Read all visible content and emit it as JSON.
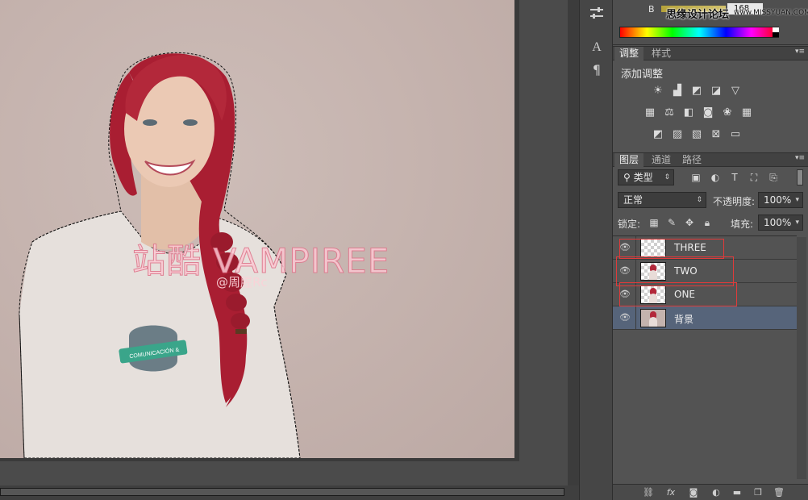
{
  "canvas": {
    "watermark_title": "站酷 VAMPIREE",
    "watermark_handle": "@周腥Rc"
  },
  "color_panel": {
    "channel_label": "B",
    "channel_value": "168",
    "overlay_site_cn": "思缘设计论坛",
    "overlay_site_url": "www.MISSYUAN.COM"
  },
  "adjustments": {
    "tabs": [
      "调整",
      "样式"
    ],
    "title": "添加调整",
    "icons_row1": [
      "brightness-icon",
      "levels-icon",
      "curves-icon",
      "exposure-icon",
      "vibrance-icon"
    ],
    "icons_row2": [
      "hue-saturation-icon",
      "color-balance-icon",
      "black-white-icon",
      "photo-filter-icon",
      "channel-mixer-icon",
      "color-lookup-icon"
    ],
    "icons_row3": [
      "invert-icon",
      "posterize-icon",
      "threshold-icon",
      "selective-color-icon",
      "gradient-map-icon"
    ]
  },
  "layers": {
    "tabs": [
      "图层",
      "通道",
      "路径"
    ],
    "filter_label": "类型",
    "blend_mode": "正常",
    "opacity_label": "不透明度:",
    "opacity_value": "100%",
    "lock_label": "锁定:",
    "fill_label": "填充:",
    "fill_value": "100%",
    "items": [
      {
        "name": "THREE",
        "visible": true,
        "selected": false,
        "highlighted": true
      },
      {
        "name": "TWO",
        "visible": true,
        "selected": false,
        "highlighted": true
      },
      {
        "name": "ONE",
        "visible": true,
        "selected": false,
        "highlighted": true
      },
      {
        "name": "背景",
        "visible": true,
        "selected": true,
        "highlighted": false
      }
    ]
  },
  "colors": {
    "panel_bg": "#535353",
    "selected_layer": "#56647a",
    "highlight_box": "#e03a3a",
    "hair": "#b3283a"
  }
}
